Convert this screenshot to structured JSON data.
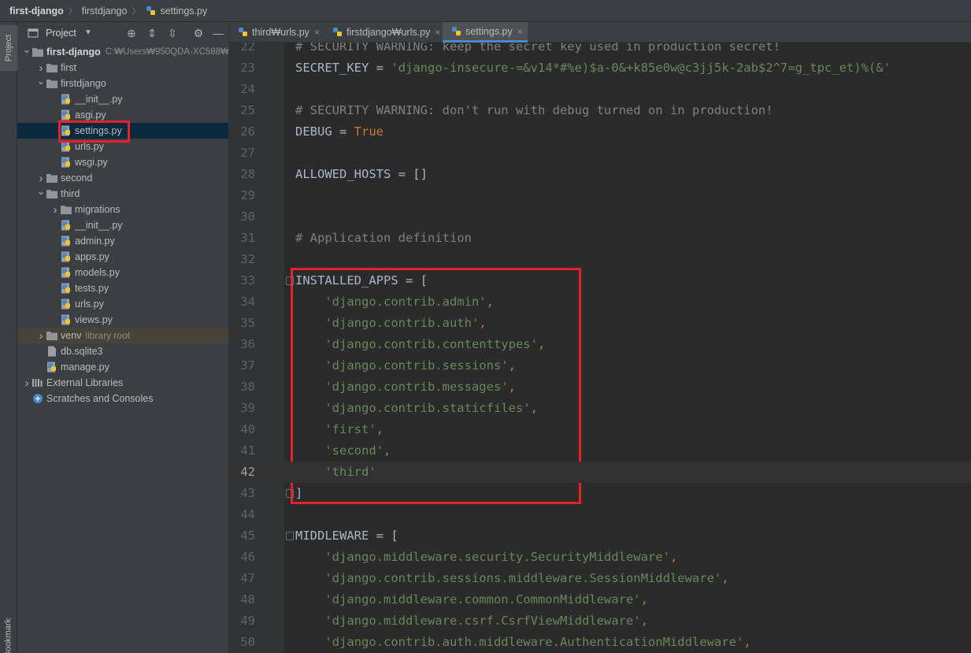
{
  "breadcrumb": [
    "first-django",
    "firstdjango",
    "settings.py"
  ],
  "tool_stripe": {
    "project_tab": "Project",
    "bookmarks_tab": "Bookmarks"
  },
  "project_panel": {
    "title": "Project",
    "tree": [
      {
        "label": "first-django",
        "hint": "C:₩Users₩950QDA-XC588₩",
        "kind": "root",
        "arrow": "down",
        "icon": "folder-icon"
      },
      {
        "label": "first",
        "arrow": "right",
        "icon": "folder-icon"
      },
      {
        "label": "firstdjango",
        "arrow": "down",
        "icon": "folder-icon"
      },
      {
        "label": "__init__.py",
        "icon": "python-file-icon"
      },
      {
        "label": "asgi.py",
        "icon": "python-file-icon"
      },
      {
        "label": "settings.py",
        "icon": "python-file-icon",
        "selected": true
      },
      {
        "label": "urls.py",
        "icon": "python-file-icon"
      },
      {
        "label": "wsgi.py",
        "icon": "python-file-icon"
      },
      {
        "label": "second",
        "arrow": "right",
        "icon": "folder-icon"
      },
      {
        "label": "third",
        "arrow": "down",
        "icon": "folder-icon"
      },
      {
        "label": "migrations",
        "arrow": "right",
        "icon": "folder-icon"
      },
      {
        "label": "__init__.py",
        "icon": "python-file-icon"
      },
      {
        "label": "admin.py",
        "icon": "python-file-icon"
      },
      {
        "label": "apps.py",
        "icon": "python-file-icon"
      },
      {
        "label": "models.py",
        "icon": "python-file-icon"
      },
      {
        "label": "tests.py",
        "icon": "python-file-icon"
      },
      {
        "label": "urls.py",
        "icon": "python-file-icon"
      },
      {
        "label": "views.py",
        "icon": "python-file-icon"
      },
      {
        "label": "venv",
        "hint": "library root",
        "arrow": "right",
        "icon": "folder-icon",
        "excluded": true
      },
      {
        "label": "db.sqlite3",
        "icon": "database-file-icon"
      },
      {
        "label": "manage.py",
        "icon": "python-file-icon"
      },
      {
        "label": "External Libraries",
        "arrow": "right",
        "icon": "libraries-icon"
      },
      {
        "label": "Scratches and Consoles",
        "icon": "scratches-icon"
      }
    ]
  },
  "tabs": [
    {
      "label": "third₩urls.py",
      "active": false
    },
    {
      "label": "firstdjango₩urls.py",
      "active": false
    },
    {
      "label": "settings.py",
      "active": true
    }
  ],
  "editor": {
    "current_line": 42,
    "lines": [
      {
        "n": 22,
        "tokens": [
          [
            "com",
            "# SECURITY WARNING: keep the secret key used in production secret!"
          ]
        ]
      },
      {
        "n": 23,
        "tokens": [
          [
            "plain",
            "SECRET_KEY = "
          ],
          [
            "str",
            "'django-insecure-=&v14*#%e)$a-0&+k85e0w@c3jj5k-2ab$2^7=g_tpc_et)%(&'"
          ]
        ]
      },
      {
        "n": 24,
        "tokens": []
      },
      {
        "n": 25,
        "tokens": [
          [
            "com",
            "# SECURITY WARNING: don't run with debug turned on in production!"
          ]
        ]
      },
      {
        "n": 26,
        "tokens": [
          [
            "plain",
            "DEBUG = "
          ],
          [
            "kw",
            "True"
          ]
        ]
      },
      {
        "n": 27,
        "tokens": []
      },
      {
        "n": 28,
        "tokens": [
          [
            "plain",
            "ALLOWED_HOSTS = []"
          ]
        ]
      },
      {
        "n": 29,
        "tokens": []
      },
      {
        "n": 30,
        "tokens": []
      },
      {
        "n": 31,
        "tokens": [
          [
            "com",
            "# Application definition"
          ]
        ]
      },
      {
        "n": 32,
        "tokens": []
      },
      {
        "n": 33,
        "fold": true,
        "tokens": [
          [
            "plain",
            "INSTALLED_APPS = ["
          ]
        ]
      },
      {
        "n": 34,
        "tokens": [
          [
            "plain",
            "    "
          ],
          [
            "str",
            "'django.contrib.admin'"
          ],
          [
            "kw",
            ","
          ]
        ]
      },
      {
        "n": 35,
        "tokens": [
          [
            "plain",
            "    "
          ],
          [
            "str",
            "'django.contrib.auth'"
          ],
          [
            "kw",
            ","
          ]
        ]
      },
      {
        "n": 36,
        "tokens": [
          [
            "plain",
            "    "
          ],
          [
            "str",
            "'django.contrib.contenttypes'"
          ],
          [
            "kw",
            ","
          ]
        ]
      },
      {
        "n": 37,
        "tokens": [
          [
            "plain",
            "    "
          ],
          [
            "str",
            "'django.contrib.sessions'"
          ],
          [
            "kw",
            ","
          ]
        ]
      },
      {
        "n": 38,
        "tokens": [
          [
            "plain",
            "    "
          ],
          [
            "str",
            "'django.contrib.messages'"
          ],
          [
            "kw",
            ","
          ]
        ]
      },
      {
        "n": 39,
        "tokens": [
          [
            "plain",
            "    "
          ],
          [
            "str",
            "'django.contrib.staticfiles'"
          ],
          [
            "kw",
            ","
          ]
        ]
      },
      {
        "n": 40,
        "tokens": [
          [
            "plain",
            "    "
          ],
          [
            "str",
            "'first'"
          ],
          [
            "kw",
            ","
          ]
        ]
      },
      {
        "n": 41,
        "tokens": [
          [
            "plain",
            "    "
          ],
          [
            "str",
            "'second'"
          ],
          [
            "kw",
            ","
          ]
        ]
      },
      {
        "n": 42,
        "tokens": [
          [
            "plain",
            "    "
          ],
          [
            "str",
            "'third'"
          ]
        ]
      },
      {
        "n": 43,
        "fold": true,
        "tokens": [
          [
            "plain",
            "]"
          ]
        ]
      },
      {
        "n": 44,
        "tokens": []
      },
      {
        "n": 45,
        "fold": true,
        "tokens": [
          [
            "plain",
            "MIDDLEWARE = ["
          ]
        ]
      },
      {
        "n": 46,
        "tokens": [
          [
            "plain",
            "    "
          ],
          [
            "str",
            "'django.middleware.security.SecurityMiddleware'"
          ],
          [
            "kw",
            ","
          ]
        ]
      },
      {
        "n": 47,
        "tokens": [
          [
            "plain",
            "    "
          ],
          [
            "str",
            "'django.contrib.sessions.middleware.SessionMiddleware'"
          ],
          [
            "kw",
            ","
          ]
        ]
      },
      {
        "n": 48,
        "tokens": [
          [
            "plain",
            "    "
          ],
          [
            "str",
            "'django.middleware.common.CommonMiddleware'"
          ],
          [
            "kw",
            ","
          ]
        ]
      },
      {
        "n": 49,
        "tokens": [
          [
            "plain",
            "    "
          ],
          [
            "str",
            "'django.middleware.csrf.CsrfViewMiddleware'"
          ],
          [
            "kw",
            ","
          ]
        ]
      },
      {
        "n": 50,
        "tokens": [
          [
            "plain",
            "    "
          ],
          [
            "str",
            "'django.contrib.auth.middleware.AuthenticationMiddleware'"
          ],
          [
            "kw",
            ","
          ]
        ]
      }
    ]
  },
  "colors": {
    "highlight_box": "#e8202a",
    "selection": "#0d293e",
    "accent": "#4a88c7"
  }
}
